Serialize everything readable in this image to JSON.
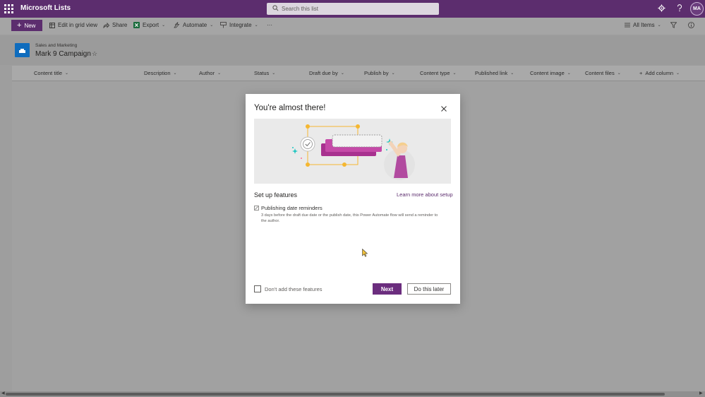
{
  "suite_bar": {
    "app_name": "Microsoft Lists",
    "search_placeholder": "Search this list",
    "avatar_initials": "MA",
    "icons": [
      "waffle-icon",
      "search-icon",
      "settings-icon",
      "help-icon"
    ]
  },
  "command_bar": {
    "new_label": "New",
    "edit_grid_label": "Edit in grid view",
    "share_label": "Share",
    "export_label": "Export",
    "automate_label": "Automate",
    "integrate_label": "Integrate",
    "more_label": "···",
    "view_label": "All Items"
  },
  "header": {
    "site_name": "Sales and Marketing",
    "list_name": "Mark 9 Campaign"
  },
  "columns": [
    {
      "label": "Content title"
    },
    {
      "label": "Description"
    },
    {
      "label": "Author"
    },
    {
      "label": "Status"
    },
    {
      "label": "Draft due by"
    },
    {
      "label": "Publish by"
    },
    {
      "label": "Content type"
    },
    {
      "label": "Published link"
    },
    {
      "label": "Content image"
    },
    {
      "label": "Content files"
    },
    {
      "label": "Add column"
    }
  ],
  "dialog": {
    "title": "You're almost there!",
    "section_title": "Set up features",
    "learn_more": "Learn more about setup",
    "feature_title": "Publishing date reminders",
    "feature_description": "3 days before the draft due date or the publish date, this Power Automate flow will send a reminder to the author.",
    "checkbox_label": "Don't add these features",
    "next_label": "Next",
    "later_label": "Do this later"
  },
  "colors": {
    "brand": "#5c2d6e",
    "accent": "#6b2d7e",
    "overlay": "#9e9e9e"
  }
}
